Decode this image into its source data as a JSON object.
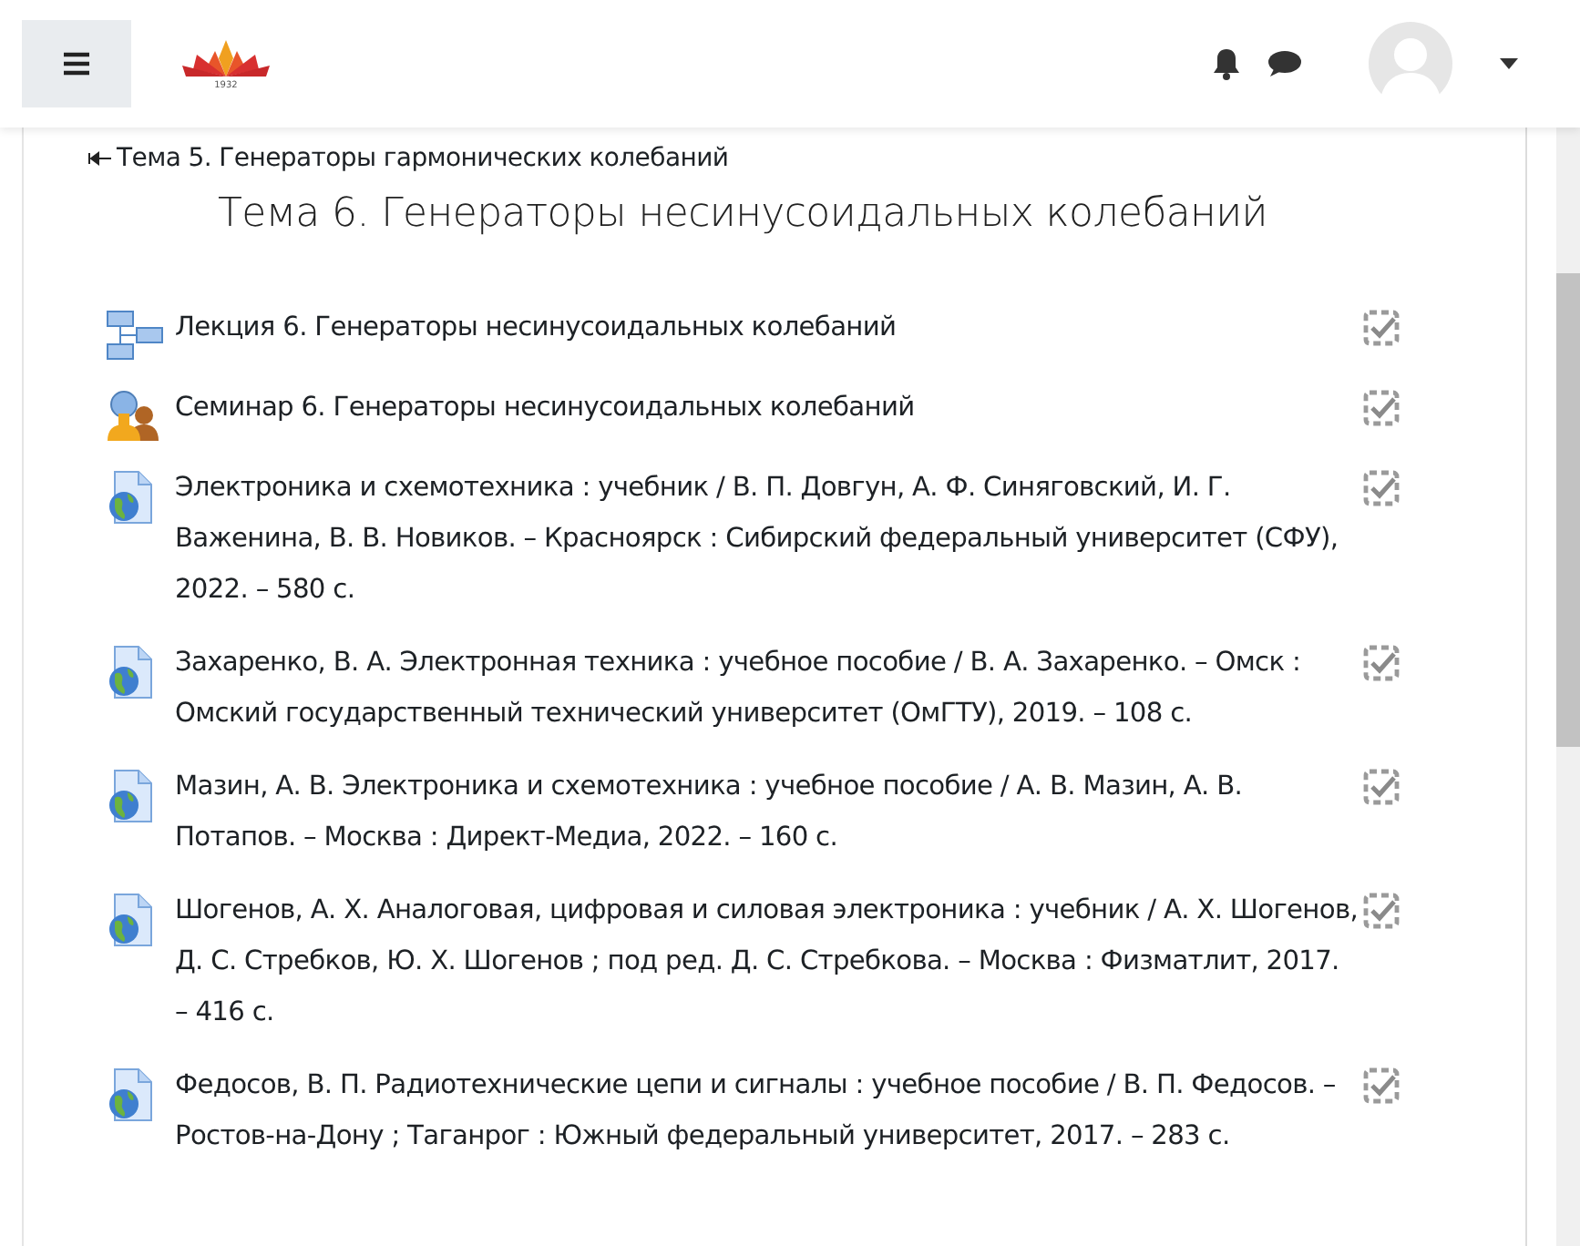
{
  "header": {
    "logo_year": "1932"
  },
  "prev_section": {
    "label": "Тема 5. Генераторы гармонических колебаний"
  },
  "section_title": "Тема 6. Генераторы несинусоидальных колебаний",
  "activities": [
    {
      "kind": "page",
      "title": "Лекция 6. Генераторы несинусоидальных колебаний",
      "completed": true
    },
    {
      "kind": "seminar",
      "title": "Семинар 6. Генераторы несинусоидальных колебаний",
      "completed": true
    },
    {
      "kind": "url",
      "title": "Электроника и схемотехника : учебник / В. П. Довгун, А. Ф. Синяговский, И. Г. Важенина, В. В. Новиков. – Красноярск : Сибирский федеральный университет (СФУ), 2022. – 580 с.",
      "completed": true
    },
    {
      "kind": "url",
      "title": "Захаренко, В. А. Электронная техника : учебное пособие / В. А. Захаренко. – Омск : Омский государственный технический университет (ОмГТУ), 2019. – 108 с.",
      "completed": true
    },
    {
      "kind": "url",
      "title": "Мазин, А. В. Электроника и схемотехника : учебное пособие / А. В. Мазин, А. В. Потапов. – Москва : Директ-Медиа, 2022. – 160 с.",
      "completed": true
    },
    {
      "kind": "url",
      "title": "Шогенов, А. Х. Аналоговая, цифровая и силовая электроника : учебник / А. Х. Шогенов, Д. С. Стребков, Ю. Х. Шогенов ; под ред. Д. С. Стребкова. – Москва : Физматлит, 2017. – 416 с.",
      "completed": true
    },
    {
      "kind": "url",
      "title": "Федосов, В. П. Радиотехнические цепи и сигналы : учебное пособие / В. П. Федосов. – Ростов-на-Дону ; Таганрог : Южный федеральный университет, 2017. – 283 с.",
      "completed": true
    }
  ]
}
